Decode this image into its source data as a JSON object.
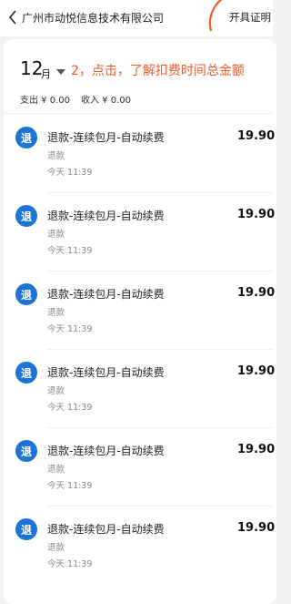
{
  "header": {
    "title": "广州市动悦信息技术有限公司",
    "certificate_label": "开具证明"
  },
  "summary": {
    "month": "12",
    "month_unit": "月",
    "annotation": "2，点击，了解扣费时间总金额",
    "spend": "支出 ¥ 0.00",
    "income": "收入 ¥ 0.00",
    "annotation_color": "#f15b2a"
  },
  "transactions": [
    {
      "badge": "退",
      "title": "退款-连续包月-自动续费",
      "amount": "19.90",
      "subtitle": "退款",
      "time": "今天 11:39"
    },
    {
      "badge": "退",
      "title": "退款-连续包月-自动续费",
      "amount": "19.90",
      "subtitle": "退款",
      "time": "今天 11:39"
    },
    {
      "badge": "退",
      "title": "退款-连续包月-自动续费",
      "amount": "19.90",
      "subtitle": "退款",
      "time": "今天 11:39"
    },
    {
      "badge": "退",
      "title": "退款-连续包月-自动续费",
      "amount": "19.90",
      "subtitle": "退款",
      "time": "今天 11:39"
    },
    {
      "badge": "退",
      "title": "退款-连续包月-自动续费",
      "amount": "19.90",
      "subtitle": "退款",
      "time": "今天 11:39"
    },
    {
      "badge": "退",
      "title": "退款-连续包月-自动续费",
      "amount": "19.90",
      "subtitle": "退款",
      "time": "今天 11:39"
    }
  ],
  "colors": {
    "badge_blue": "#1e73d8",
    "annotation_orange": "#f15b2a"
  }
}
